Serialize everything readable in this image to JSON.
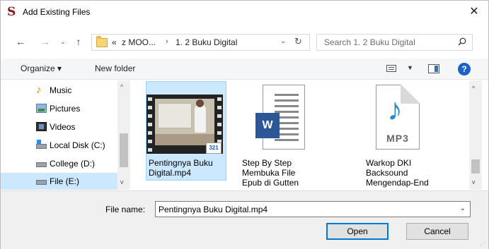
{
  "window": {
    "title": "Add Existing Files",
    "app_icon_glyph": "S",
    "close_glyph": "✕"
  },
  "nav": {
    "back_glyph": "←",
    "forward_glyph": "→",
    "recent_glyph": "⌄",
    "up_glyph": "↑"
  },
  "address": {
    "overflow": "«",
    "crumbs": [
      "z MOO...",
      "1. 2 Buku Digital"
    ],
    "separator": "›",
    "dropdown_glyph": "⌄",
    "refresh_glyph": "↻"
  },
  "search": {
    "placeholder": "Search 1. 2 Buku Digital"
  },
  "toolbar": {
    "organize_label": "Organize ▾",
    "new_folder_label": "New folder",
    "view_dropdown_glyph": "▼",
    "help_glyph": "?"
  },
  "nav_pane": {
    "items": [
      {
        "label": "Music",
        "icon": "music-icon"
      },
      {
        "label": "Pictures",
        "icon": "pictures-icon"
      },
      {
        "label": "Videos",
        "icon": "videos-icon"
      },
      {
        "label": "Local Disk (C:)",
        "icon": "windows-disk-icon"
      },
      {
        "label": "College (D:)",
        "icon": "disk-icon"
      },
      {
        "label": "File (E:)",
        "icon": "disk-icon",
        "selected": true
      }
    ],
    "scroll_up_glyph": "^",
    "scroll_down_glyph": "v"
  },
  "files": {
    "items": [
      {
        "name_lines": [
          "Pentingnya Buku",
          "Digital.mp4"
        ],
        "type": "video",
        "badge": "321",
        "selected": true
      },
      {
        "name_lines": [
          "Step By Step",
          "Membuka File",
          "Epub di Gutten"
        ],
        "type": "word-document",
        "badge": "W"
      },
      {
        "name_lines": [
          "Warkop DKI",
          "Backsound",
          "Mengendap-End"
        ],
        "type": "mp3",
        "badge": "MP3",
        "note_glyph": "♪"
      }
    ],
    "scroll_up_glyph": "^",
    "scroll_down_glyph": "v"
  },
  "bottom": {
    "file_name_label": "File name:",
    "file_name_value": "Pentingnya Buku Digital.mp4",
    "dropdown_glyph": "⌄",
    "open_label": "Open",
    "cancel_label": "Cancel"
  }
}
